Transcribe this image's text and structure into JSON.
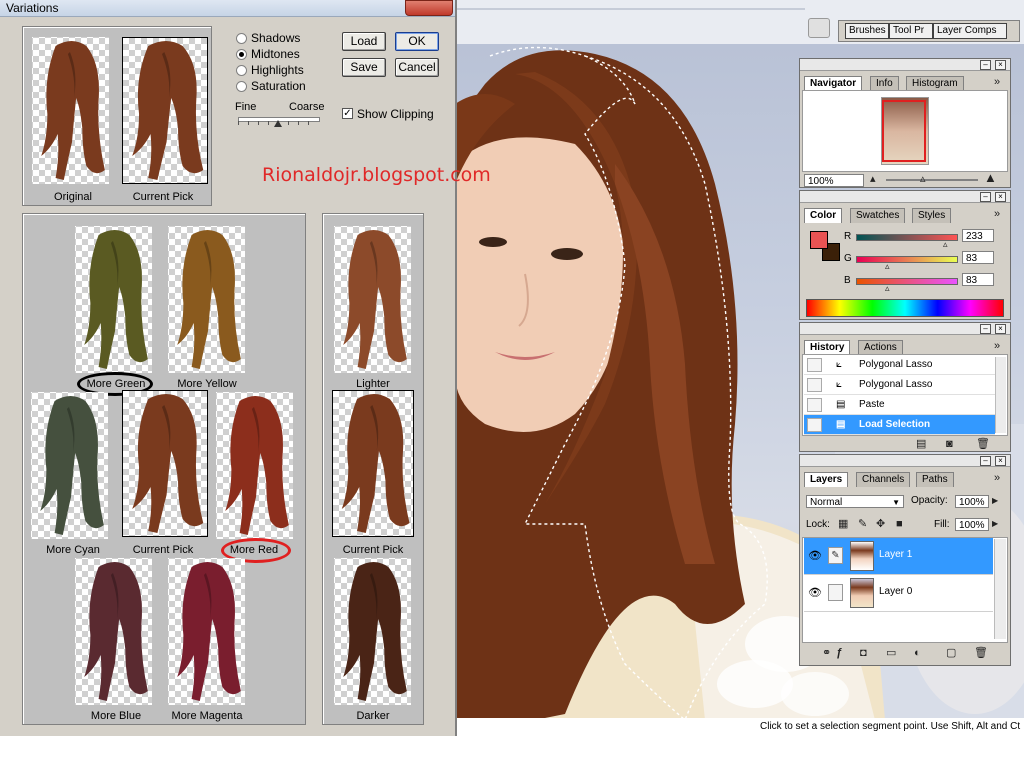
{
  "dialog": {
    "title": "Variations",
    "top_labels": {
      "original": "Original",
      "current_pick": "Current Pick"
    },
    "tones": [
      {
        "label": "Shadows",
        "checked": false
      },
      {
        "label": "Midtones",
        "checked": true
      },
      {
        "label": "Highlights",
        "checked": false
      },
      {
        "label": "Saturation",
        "checked": false
      }
    ],
    "buttons": {
      "ok": "OK",
      "load": "Load",
      "save": "Save",
      "cancel": "Cancel"
    },
    "slider": {
      "fine": "Fine",
      "coarse": "Coarse",
      "level": 0.5
    },
    "show_clipping": {
      "label": "Show Clipping",
      "checked": true
    },
    "variations": {
      "more_green": "More Green",
      "more_yellow": "More Yellow",
      "more_cyan": "More Cyan",
      "current_pick": "Current Pick",
      "more_red": "More Red",
      "more_blue": "More Blue",
      "more_magenta": "More Magenta"
    },
    "lightness": {
      "lighter": "Lighter",
      "current_pick": "Current Pick",
      "darker": "Darker"
    },
    "hair_colors": {
      "original": "#7a3a1e",
      "current": "#7a3a1e",
      "green": "#5a5a22",
      "yellow": "#8a5a1e",
      "cyan": "#45503e",
      "red": "#8c2e1c",
      "blue": "#5a2a30",
      "magenta": "#7a1e2e",
      "lighter": "#8c4a2a",
      "darker": "#4a2416"
    }
  },
  "watermark": "Rionaldojr.blogspot.com",
  "palette_well": {
    "tabs": [
      "Brushes",
      "Tool Pr",
      "Layer Comps"
    ]
  },
  "navigator": {
    "tabs": [
      "Navigator",
      "Info",
      "Histogram"
    ],
    "zoom": "100%"
  },
  "color": {
    "tabs": [
      "Color",
      "Swatches",
      "Styles"
    ],
    "foreground": "#e95353",
    "background": "#3b2008",
    "channels": [
      {
        "label": "R",
        "value": "233",
        "level": 0.91
      },
      {
        "label": "G",
        "value": "83",
        "level": 0.33
      },
      {
        "label": "B",
        "value": "83",
        "level": 0.33
      }
    ]
  },
  "history": {
    "tabs": [
      "History",
      "Actions"
    ],
    "items": [
      {
        "label": "Polygonal Lasso",
        "active": false
      },
      {
        "label": "Polygonal Lasso",
        "active": false
      },
      {
        "label": "Paste",
        "active": false
      },
      {
        "label": "Load Selection",
        "active": true
      }
    ]
  },
  "layers": {
    "tabs": [
      "Layers",
      "Channels",
      "Paths"
    ],
    "blend_mode": "Normal",
    "opacity_label": "Opacity:",
    "opacity": "100%",
    "lock_label": "Lock:",
    "fill_label": "Fill:",
    "fill": "100%",
    "items": [
      {
        "name": "Layer 1",
        "active": true
      },
      {
        "name": "Layer 0",
        "active": false
      }
    ]
  },
  "status": "Click to set a selection segment point.  Use Shift, Alt and Ct"
}
